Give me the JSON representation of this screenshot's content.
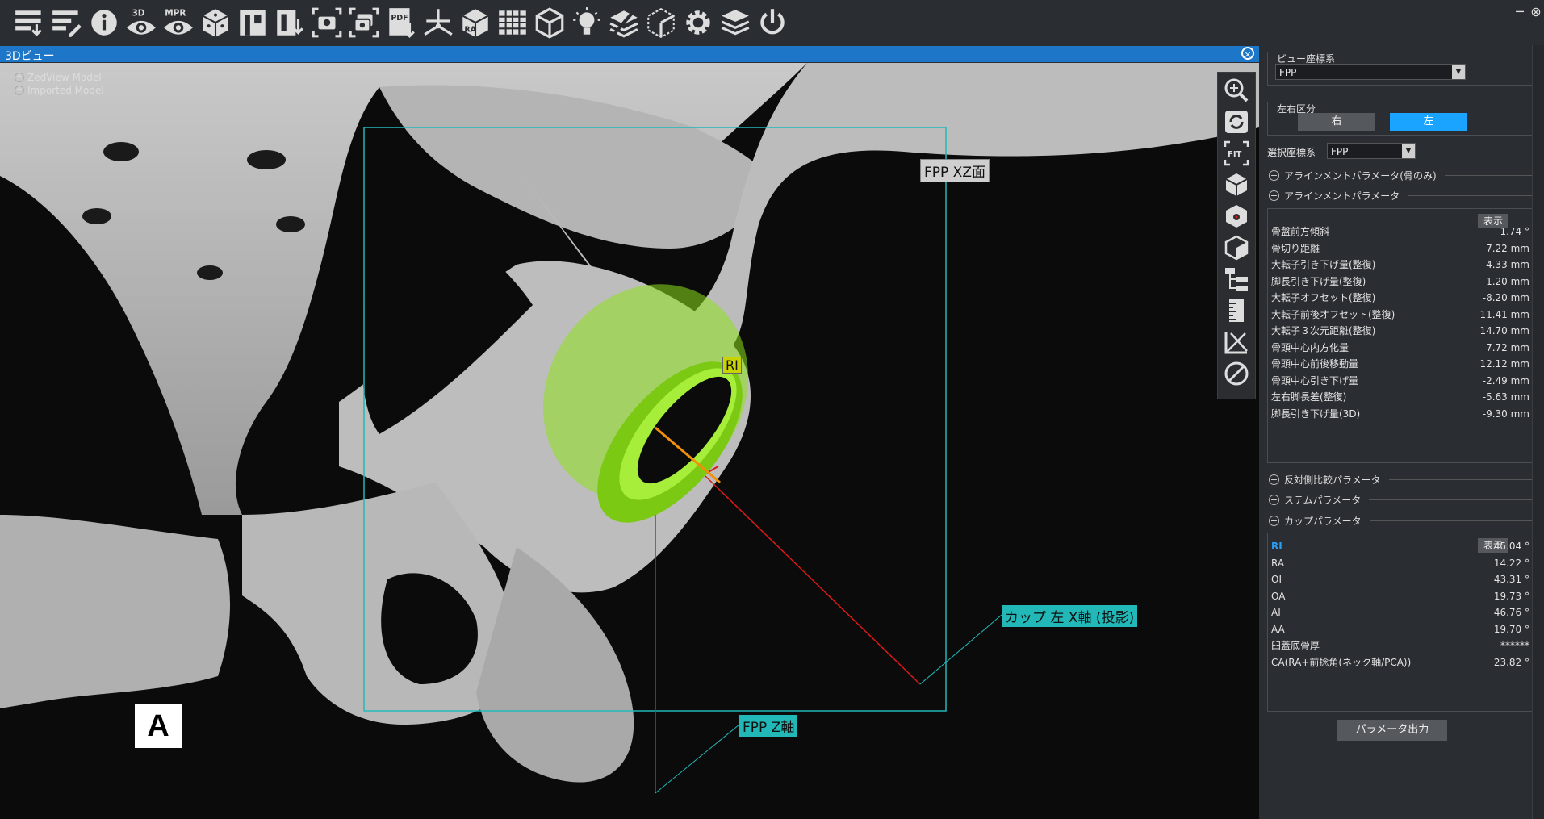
{
  "toolbar": {
    "icons": [
      "load-series-icon",
      "edit-series-icon",
      "info-icon",
      "3d-view-icon",
      "mpr-view-icon",
      "dice-icon",
      "layout-icon",
      "export-icon",
      "screenshot-icon",
      "multi-screenshot-icon",
      "pdf-export-icon",
      "axis-icon",
      "ra-box-icon",
      "grid-icon",
      "cube-icon",
      "lightbulb-icon",
      "layer-slash-icon",
      "box-wire-icon",
      "settings-icon",
      "stack-icon",
      "power-icon"
    ],
    "labels": {
      "3d": "3D",
      "mpr": "MPR",
      "pdf": "PDF",
      "ra": "RA"
    }
  },
  "window_controls": {
    "minimize": "─",
    "close": "⊗"
  },
  "view": {
    "title": "3Dビュー",
    "model_tree": [
      "ZedView Model",
      "Imported Model"
    ],
    "labels": {
      "xz_plane": "FPP XZ面",
      "cup_axis": "カップ 左 X軸 (投影)",
      "z_axis": "FPP Z軸",
      "ri": "RI"
    },
    "badge": "A",
    "tools": [
      "zoom-icon",
      "rotate-icon",
      "fit-icon",
      "cube-view-icon",
      "cube-target-icon",
      "cube-shade-icon",
      "hierarchy-icon",
      "ruler-icon",
      "measure-icon",
      "disable-icon"
    ],
    "tool_fit_label": "FIT"
  },
  "panel": {
    "view_coord": {
      "title": "ビュー座標系",
      "value": "FPP"
    },
    "side": {
      "title": "左右区分",
      "right": "右",
      "left": "左",
      "active": "左"
    },
    "select_coord": {
      "label": "選択座標系",
      "value": "FPP"
    },
    "sections": {
      "align_bone": "アラインメントパラメータ(骨のみ)",
      "align": "アラインメントパラメータ",
      "contra": "反対側比較パラメータ",
      "stem": "ステムパラメータ",
      "cup": "カップパラメータ"
    },
    "show_label": "表示",
    "align_params": [
      {
        "k": "骨盤前方傾斜",
        "v": "1.74 °"
      },
      {
        "k": "骨切り距離",
        "v": "-7.22 mm"
      },
      {
        "k": "大転子引き下げ量(整復)",
        "v": "-4.33 mm"
      },
      {
        "k": "脚長引き下げ量(整復)",
        "v": "-1.20 mm"
      },
      {
        "k": "大転子オフセット(整復)",
        "v": "-8.20 mm"
      },
      {
        "k": "大転子前後オフセット(整復)",
        "v": "11.41 mm"
      },
      {
        "k": "大転子３次元距離(整復)",
        "v": "14.70 mm"
      },
      {
        "k": "骨頭中心内方化量",
        "v": "7.72 mm"
      },
      {
        "k": "骨頭中心前後移動量",
        "v": "12.12 mm"
      },
      {
        "k": "骨頭中心引き下げ量",
        "v": "-2.49 mm"
      },
      {
        "k": "左右脚長差(整復)",
        "v": "-5.63 mm"
      },
      {
        "k": "脚長引き下げ量(3D)",
        "v": "-9.30 mm"
      }
    ],
    "cup_params": [
      {
        "k": "RI",
        "v": "45.04 °"
      },
      {
        "k": "RA",
        "v": "14.22 °"
      },
      {
        "k": "OI",
        "v": "43.31 °"
      },
      {
        "k": "OA",
        "v": "19.73 °"
      },
      {
        "k": "AI",
        "v": "46.76 °"
      },
      {
        "k": "AA",
        "v": "19.70 °"
      },
      {
        "k": "臼蓋底骨厚",
        "v": "******"
      },
      {
        "k": "CA(RA+前捻角(ネック軸/PCA))",
        "v": "23.82 °"
      }
    ],
    "export_label": "パラメータ出力",
    "colors": {
      "active_side": "#1aa3ff",
      "ri_highlight": "#2a9df4",
      "cup_green": "#8ee21a",
      "plane_cyan": "#22b8b8",
      "axis_red": "#e01818"
    }
  }
}
